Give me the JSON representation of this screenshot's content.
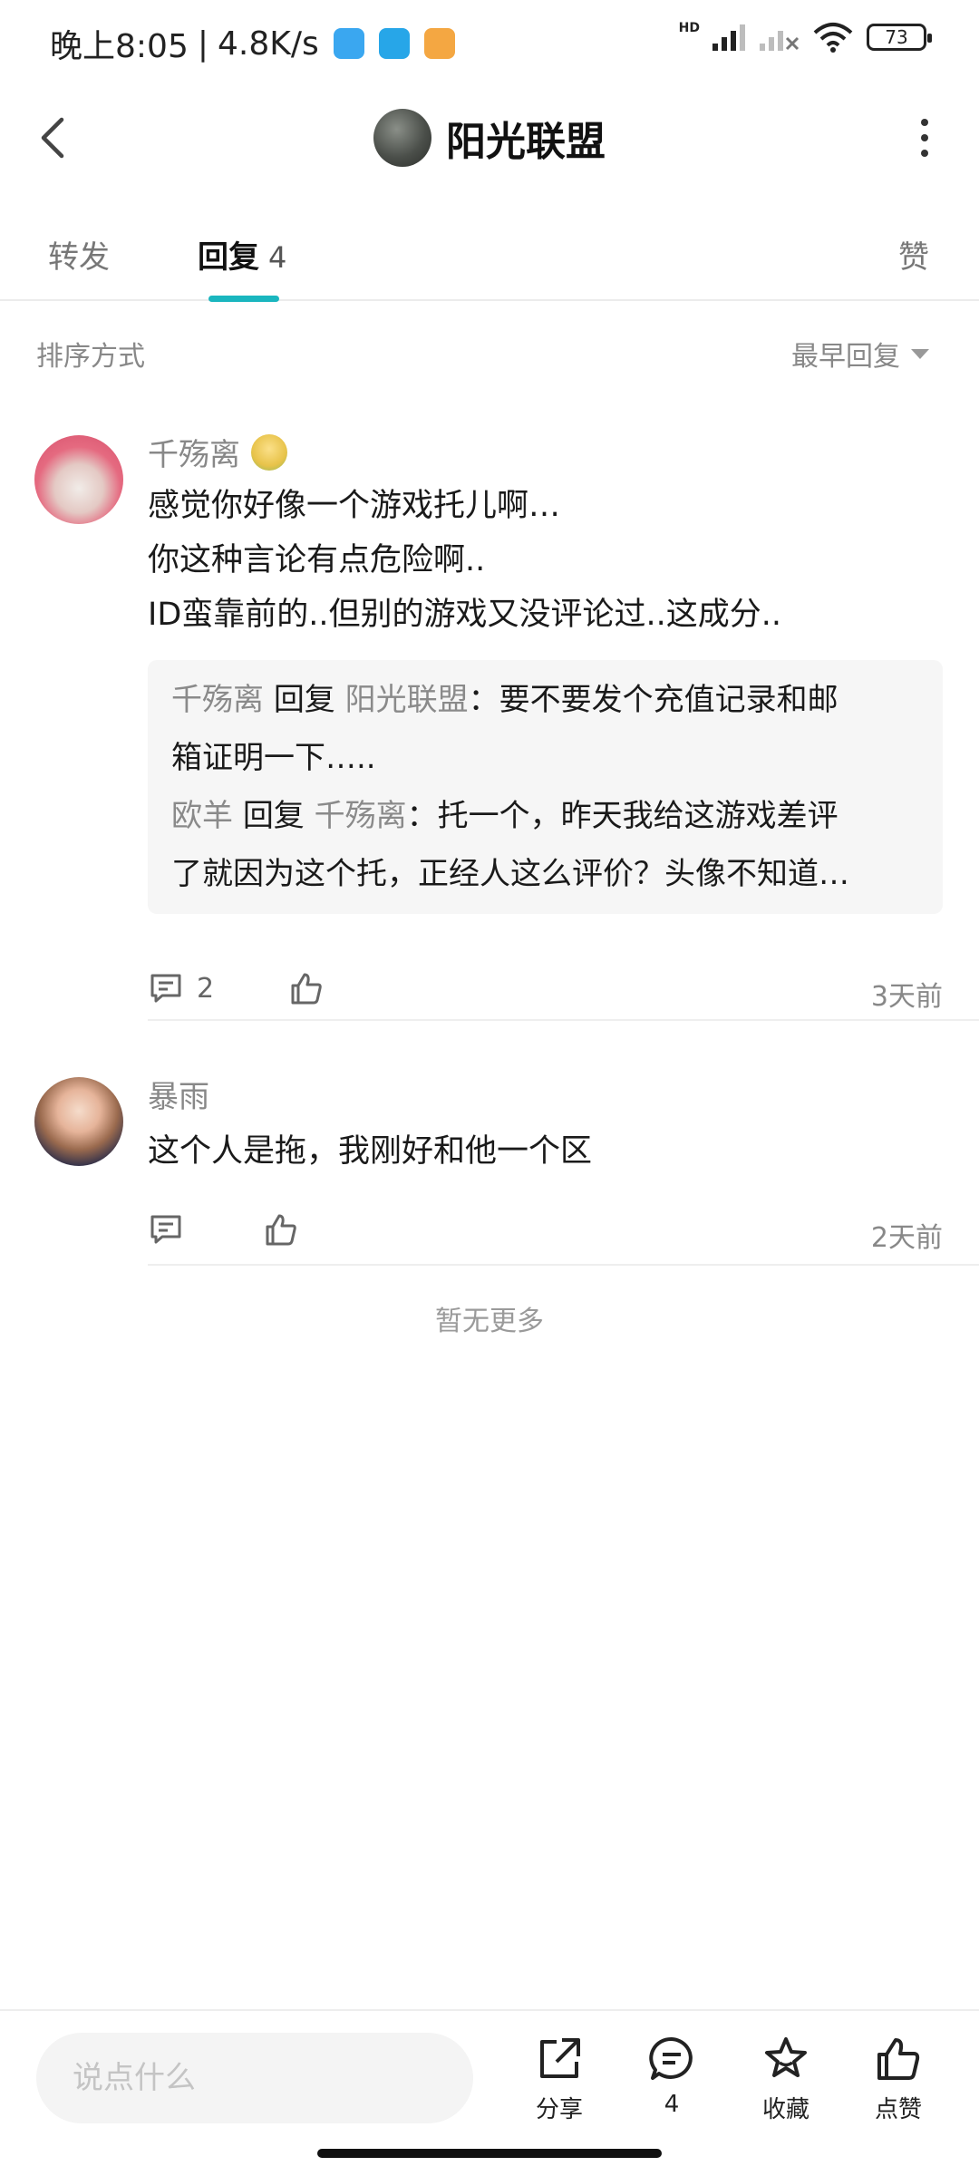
{
  "status_bar": {
    "time": "晚上8:05",
    "network_speed": "4.8K/s",
    "battery": "73",
    "network_label": "HD"
  },
  "header": {
    "title": "阳光联盟"
  },
  "tabs": {
    "forward": "转发",
    "reply": "回复",
    "reply_count": "4",
    "like": "赞"
  },
  "sort": {
    "label": "排序方式",
    "value": "最早回复"
  },
  "comments": [
    {
      "username": "千殇离",
      "lines": [
        "感觉你好像一个游戏托儿啊…",
        "你这种言论有点危险啊..",
        "ID蛮靠前的..但别的游戏又没评论过..这成分.."
      ],
      "replies": [
        {
          "from": "千殇离",
          "action": "回复",
          "to": "阳光联盟",
          "line1": "：要不要发个充值记录和邮",
          "line2": "箱证明一下…..",
          "from_name": "千殇离"
        },
        {
          "from": "欧羊",
          "action": "回复",
          "to": "千殇离",
          "line1": "：托一个，昨天我给这游戏差评",
          "line2": "了就因为这个托，正经人这么评价？头像不知道…"
        }
      ],
      "reply_count": "2",
      "time": "3天前"
    },
    {
      "username": "暴雨",
      "lines": [
        "这个人是拖，我刚好和他一个区"
      ],
      "time": "2天前"
    }
  ],
  "footer_note": "暂无更多",
  "bottom_bar": {
    "input_placeholder": "说点什么",
    "share_label": "分享",
    "comment_count": "4",
    "favorite_label": "收藏",
    "like_label": "点赞"
  },
  "colors": {
    "accent": "#1ab6bf",
    "muted_text": "#888888",
    "quote_bg": "#f6f6f6"
  }
}
